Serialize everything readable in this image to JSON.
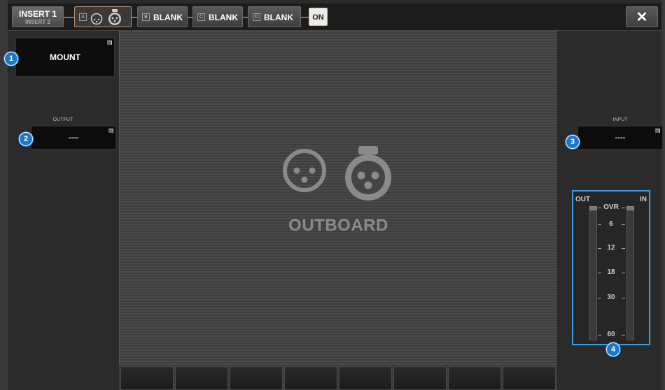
{
  "topbar": {
    "insert_label": "INSERT 1",
    "insert_sub_label": "INSERT 2",
    "slot_a_letter": "A",
    "slots": [
      {
        "letter": "B",
        "label": "BLANK"
      },
      {
        "letter": "C",
        "label": "BLANK"
      },
      {
        "letter": "D",
        "label": "BLANK"
      }
    ],
    "on_label": "ON",
    "close_label": "✕"
  },
  "left": {
    "mount_label": "MOUNT",
    "output_label": "OUTPUT",
    "output_value": "----"
  },
  "main": {
    "outboard_label": "OUTBOARD"
  },
  "right": {
    "input_label": "INPUT",
    "input_value": "----",
    "meter": {
      "out_label": "OUT",
      "in_label": "IN",
      "scale": [
        "OVR",
        "6",
        "12",
        "18",
        "30",
        "60"
      ]
    }
  },
  "callouts": [
    "1",
    "2",
    "3",
    "4"
  ],
  "colors": {
    "callout_blue": "#1e78c8",
    "meter_border": "#3e9fe0",
    "slot_a_border": "#c98f6a",
    "on_button": "#f0ebe4"
  },
  "icons": {
    "xlr_female": "xlr-female-icon",
    "xlr_male": "xlr-male-icon",
    "close": "close-icon"
  }
}
